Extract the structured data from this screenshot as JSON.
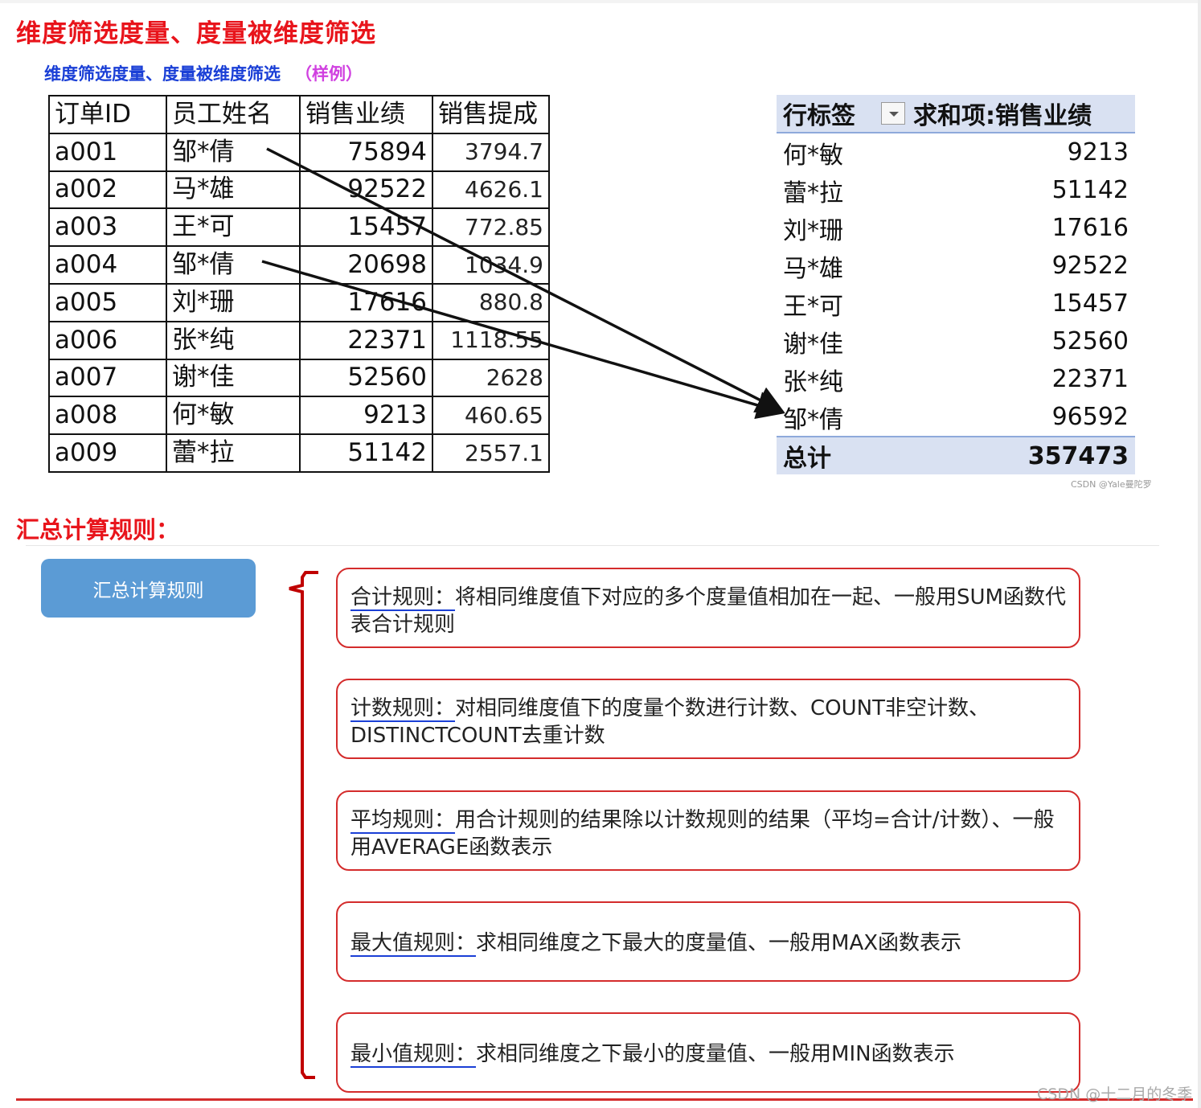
{
  "title": "维度筛选度量、度量被维度筛选",
  "subtitle": "维度筛选度量、度量被维度筛选",
  "subtitle_tag": "（样例）",
  "source_table": {
    "headers": [
      "订单ID",
      "员工姓名",
      "销售业绩",
      "销售提成"
    ],
    "rows": [
      [
        "a001",
        "邹*倩",
        "75894",
        "3794.7"
      ],
      [
        "a002",
        "马*雄",
        "92522",
        "4626.1"
      ],
      [
        "a003",
        "王*可",
        "15457",
        "772.85"
      ],
      [
        "a004",
        "邹*倩",
        "20698",
        "1034.9"
      ],
      [
        "a005",
        "刘*珊",
        "17616",
        "880.8"
      ],
      [
        "a006",
        "张*纯",
        "22371",
        "1118.55"
      ],
      [
        "a007",
        "谢*佳",
        "52560",
        "2628"
      ],
      [
        "a008",
        "何*敏",
        "9213",
        "460.65"
      ],
      [
        "a009",
        "蕾*拉",
        "51142",
        "2557.1"
      ]
    ]
  },
  "pivot": {
    "row_label": "行标签",
    "value_label": "求和项:销售业绩",
    "rows": [
      [
        "何*敏",
        "9213"
      ],
      [
        "蕾*拉",
        "51142"
      ],
      [
        "刘*珊",
        "17616"
      ],
      [
        "马*雄",
        "92522"
      ],
      [
        "王*可",
        "15457"
      ],
      [
        "谢*佳",
        "52560"
      ],
      [
        "张*纯",
        "22371"
      ],
      [
        "邹*倩",
        "96592"
      ]
    ],
    "total_label": "总计",
    "total_value": "357473"
  },
  "watermark_small": "CSDN @Yale曼陀罗",
  "section_title": "汇总计算规则：",
  "rule_button": "汇总计算规则",
  "rules": [
    {
      "key": "合计规则：",
      "text": "将相同维度值下对应的多个度量值相加在一起、一般用SUM函数代表合计规则"
    },
    {
      "key": "计数规则：",
      "text": "对相同维度值下的度量个数进行计数、COUNT非空计数、DISTINCTCOUNT去重计数"
    },
    {
      "key": "平均规则：",
      "text": "用合计规则的结果除以计数规则的结果（平均=合计/计数）、一般用AVERAGE函数表示"
    },
    {
      "key": "最大值规则：",
      "text": "求相同维度之下最大的度量值、一般用MAX函数表示"
    },
    {
      "key": "最小值规则：",
      "text": "求相同维度之下最小的度量值、一般用MIN函数表示"
    }
  ],
  "watermark_bottom": "CSDN @十二月的冬季"
}
